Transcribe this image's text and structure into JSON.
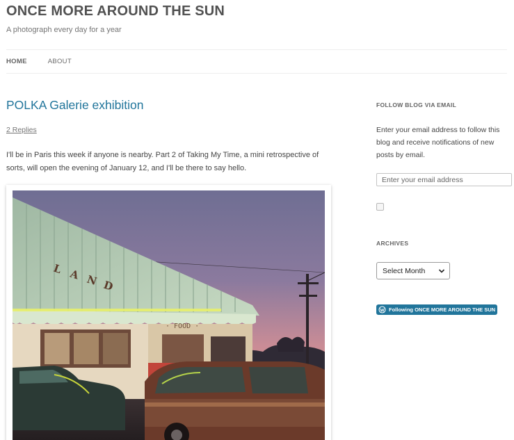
{
  "site": {
    "title": "ONCE MORE AROUND THE SUN",
    "tagline": "A photograph every day for a year"
  },
  "nav": {
    "items": [
      {
        "label": "HOME",
        "current": true
      },
      {
        "label": "ABOUT",
        "current": false
      }
    ]
  },
  "post": {
    "title": "POLKA Galerie exhibition",
    "replies": "2 Replies",
    "body": "I'll be in Paris this week if anyone is nearby. Part 2 of Taking My Time, a mini retrospective of sorts, will open the evening of January 12, and I'll be there to say hello.",
    "photo": {
      "sign_text": "LAND",
      "food_text": "FOOD"
    }
  },
  "sidebar": {
    "follow_title": "FOLLOW BLOG VIA EMAIL",
    "follow_text": "Enter your email address to follow this blog and receive notifications of new posts by email.",
    "email_placeholder": "Enter your email address",
    "archives_title": "ARCHIVES",
    "archives_selected": "Select Month",
    "following_badge": "Following ONCE MORE AROUND THE SUN",
    "badge_icon": "wordpress-icon"
  },
  "colors": {
    "link": "#21759b",
    "text": "#444444",
    "rule": "#ededed"
  }
}
